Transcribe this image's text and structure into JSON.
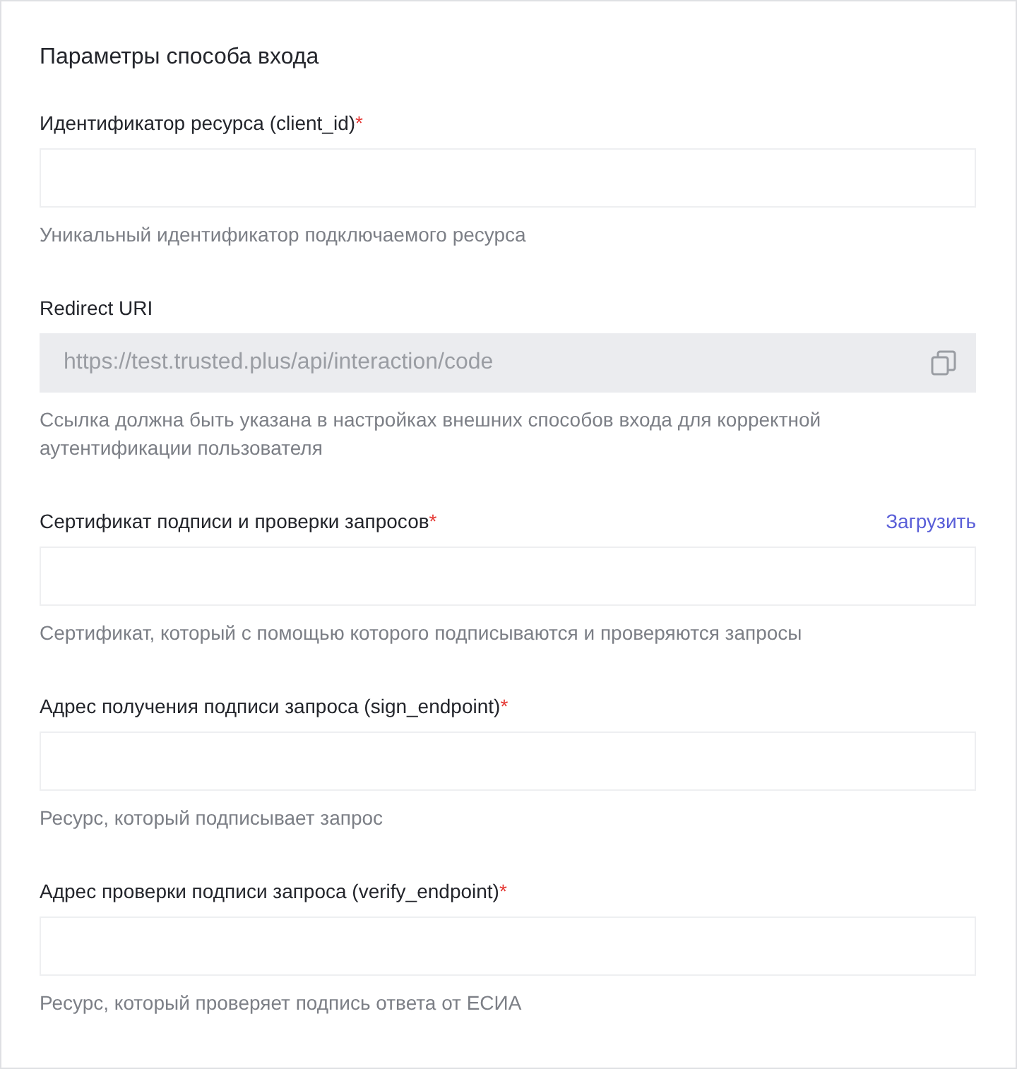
{
  "title": "Параметры способа входа",
  "fields": [
    {
      "kind": "text",
      "label": "Идентификатор ресурса (client_id)",
      "required_mark": "*",
      "hint": "Уникальный идентификатор подключаемого ресурса"
    },
    {
      "kind": "readonly",
      "label": "Redirect URI",
      "value": "https://test.trusted.plus/api/interaction/code",
      "hint": "Ссылка должна быть указана в настройках внешних способов входа для корректной аутентификации пользователя"
    },
    {
      "kind": "text",
      "label": "Сертификат подписи и проверки запросов",
      "required_mark": "*",
      "action": "Загрузить",
      "hint": "Сертификат, который с помощью которого подписываются и проверяются запросы"
    },
    {
      "kind": "text",
      "label": "Адрес получения подписи запроса (sign_endpoint)",
      "required_mark": "*",
      "hint": "Ресурс, который подписывает запрос"
    },
    {
      "kind": "text",
      "label": "Адрес проверки подписи запроса (verify_endpoint)",
      "required_mark": "*",
      "hint": "Ресурс, который проверяет подпись ответа от ЕСИА"
    }
  ]
}
